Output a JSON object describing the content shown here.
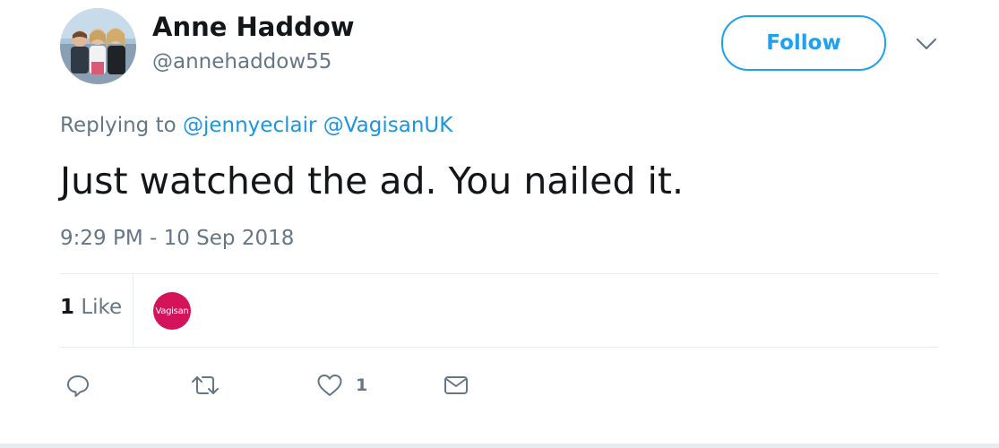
{
  "author": {
    "display_name": "Anne Haddow",
    "screen_name": "@annehaddow55",
    "avatar_icon": "profile-photo"
  },
  "follow": {
    "label": "Follow",
    "color": "#1da1f2"
  },
  "menu": {
    "icon": "chevron-down-icon"
  },
  "reply": {
    "prefix": "Replying to",
    "mentions": [
      "@jennyeclair",
      "@VagisanUK"
    ]
  },
  "tweet": {
    "text": "Just watched the ad. You nailed it.",
    "timestamp": "9:29 PM - 10 Sep 2018"
  },
  "stats": {
    "likes_count": "1",
    "likes_label": "Like",
    "likers": [
      {
        "label": "Vagisan",
        "color": "#d5135b"
      }
    ]
  },
  "actions": {
    "reply_icon": "reply-icon",
    "retweet_icon": "retweet-icon",
    "like_icon": "heart-icon",
    "like_count": "1",
    "dm_icon": "envelope-icon"
  },
  "colors": {
    "link": "#1b95e0",
    "secondary_text": "#657786",
    "primary_text": "#14171a"
  }
}
